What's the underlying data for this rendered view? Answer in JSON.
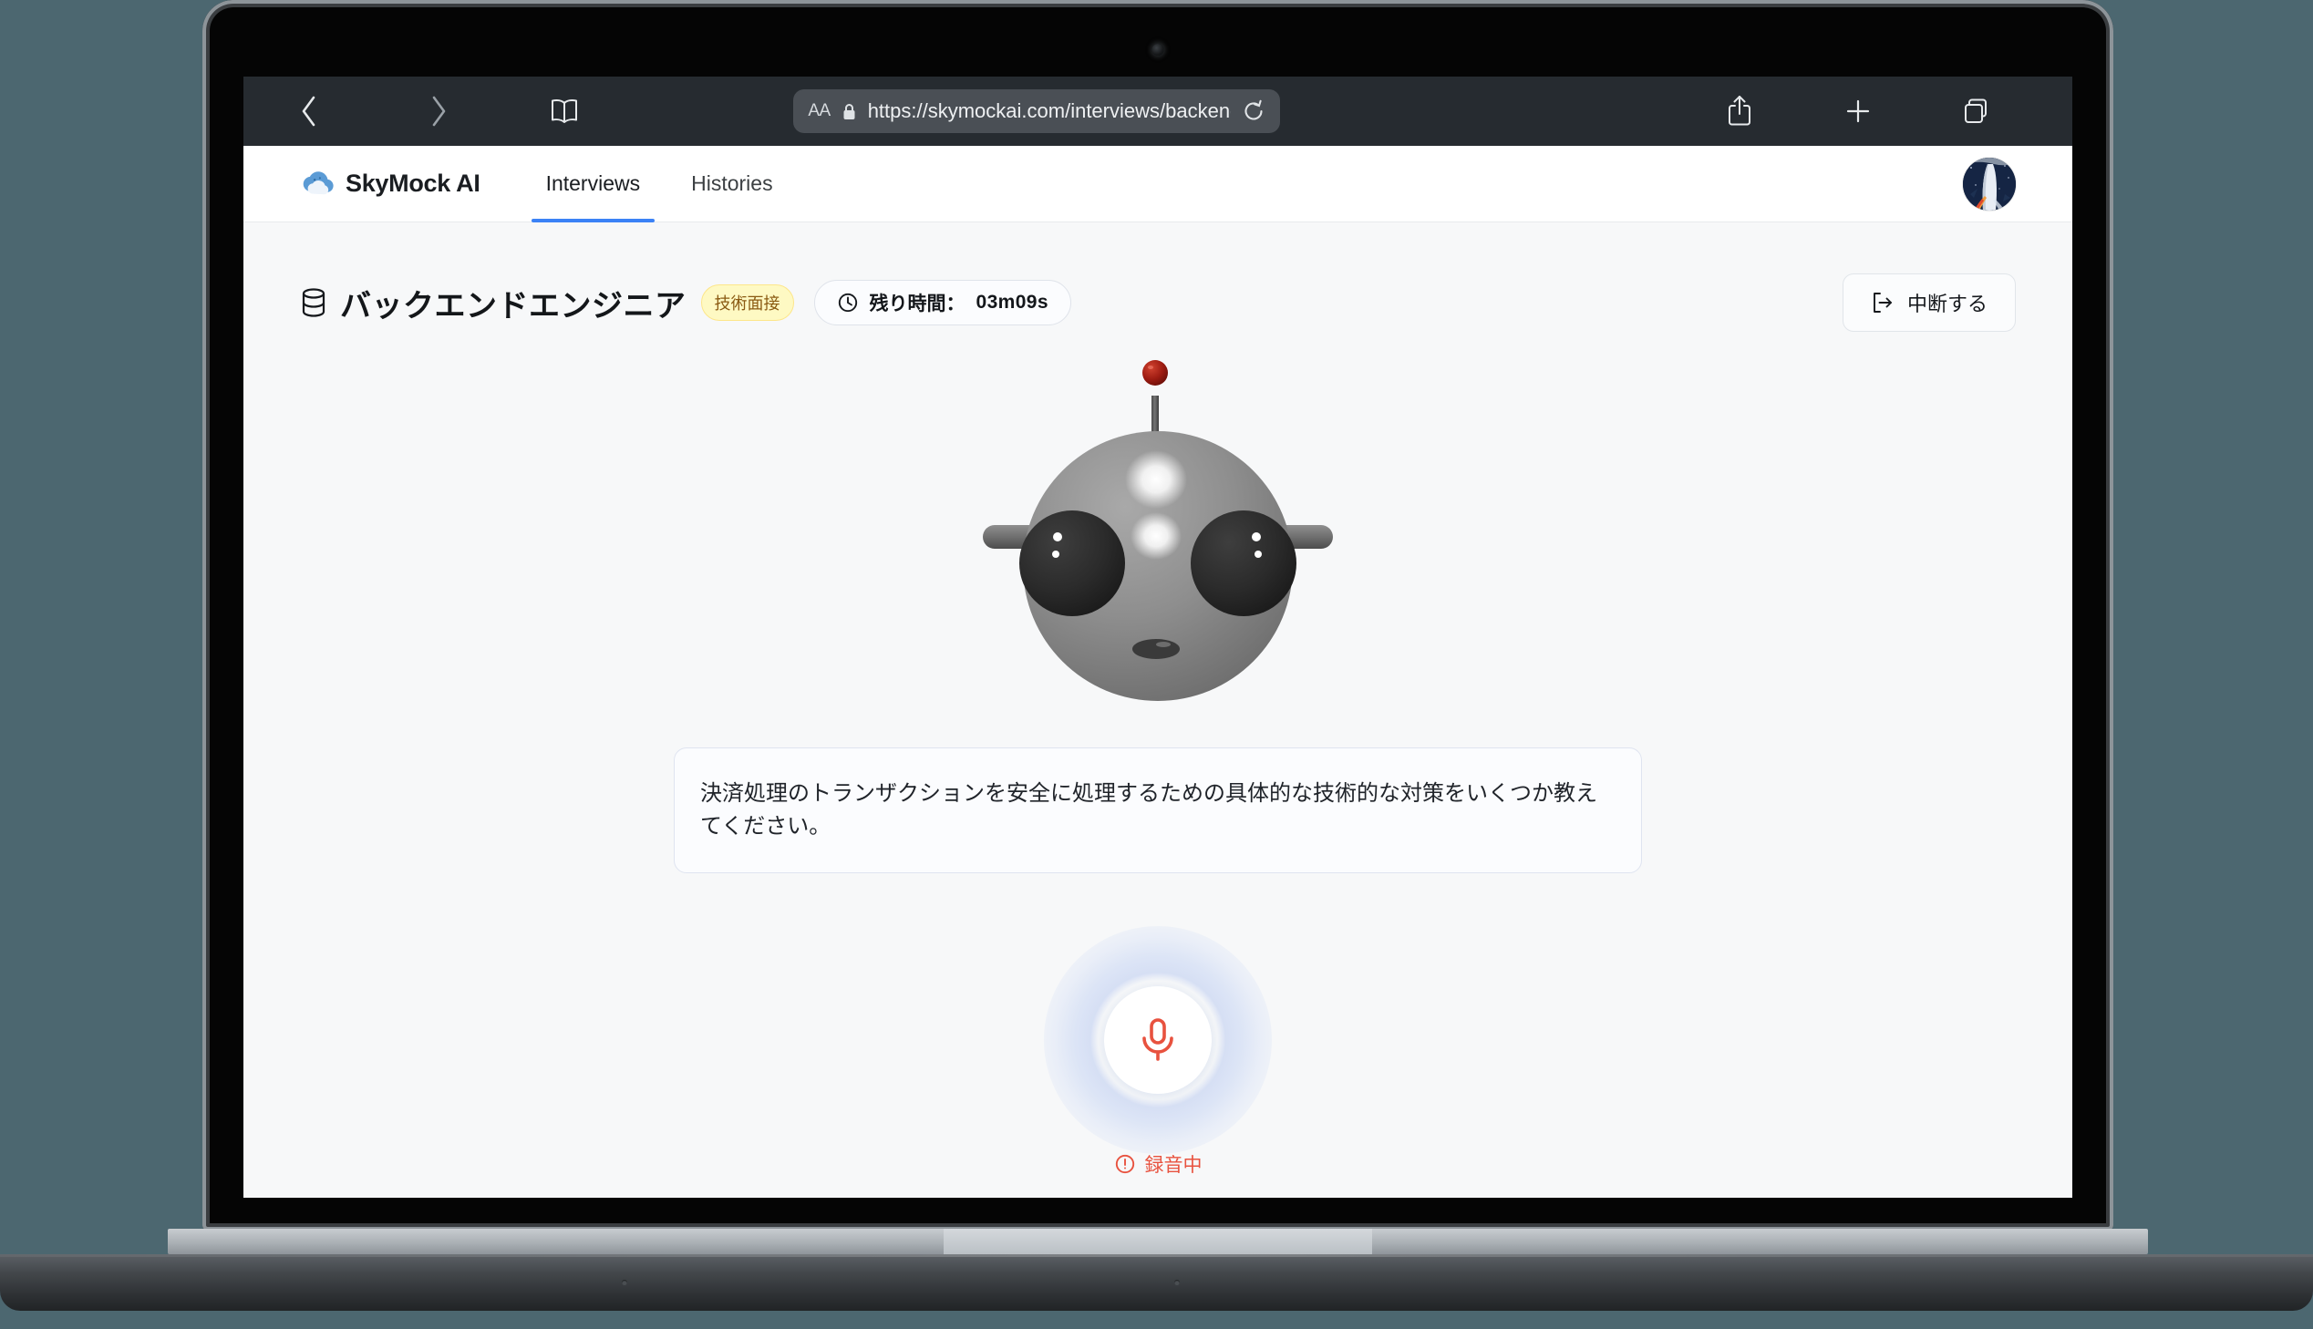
{
  "browser": {
    "back_icon": "chevron-left-icon",
    "forward_icon": "chevron-right-icon",
    "bookmarks_icon": "book-icon",
    "text_size_label": "AA",
    "lock_icon": "lock-icon",
    "url": "https://skymockai.com/interviews/backend/intervi",
    "reload_icon": "reload-icon",
    "share_icon": "share-icon",
    "new_tab_icon": "plus-icon",
    "tabs_icon": "tabs-icon"
  },
  "topnav": {
    "logo_icon": "cloud-logo-icon",
    "brand": "SkyMock AI",
    "tabs": [
      {
        "label": "Interviews",
        "active": true
      },
      {
        "label": "Histories",
        "active": false
      }
    ],
    "avatar_name": "user-avatar-rocket-launch"
  },
  "page": {
    "title_icon": "database-icon",
    "title": "バックエンドエンジニア",
    "badge": "技術面接",
    "timer": {
      "icon": "clock-icon",
      "label": "残り時間：",
      "value": "03m09s"
    },
    "abort_button": {
      "icon": "logout-icon",
      "label": "中断する"
    }
  },
  "avatar3d": {
    "name": "robot-interviewer-head",
    "body_color": "#8b8b8b",
    "eye_color": "#2e2e2e",
    "antenna_light_color": "#b01a12"
  },
  "question": {
    "text": "決済処理のトランザクションを安全に処理するための具体的な技術的な対策をいくつか教えてください。"
  },
  "recorder": {
    "mic_icon": "microphone-icon",
    "status_icon": "alert-circle-icon",
    "status_text": "録音中",
    "status_color": "#e8523f",
    "halo_color": "#93aee8"
  },
  "colors": {
    "accent": "#3b82f6",
    "page_bg": "#f7f8f9",
    "desk_bg": "#4c6770",
    "badge_bg": "#fef9c3",
    "badge_text": "#8a5a12"
  }
}
